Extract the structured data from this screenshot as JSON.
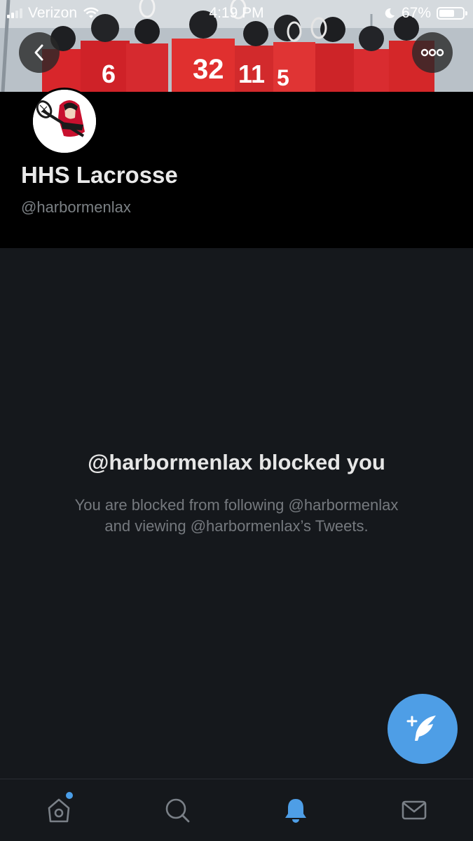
{
  "status_bar": {
    "carrier": "Verizon",
    "time": "4:19 PM",
    "battery": "67%",
    "battery_level": 0.67,
    "signal_bars": 2
  },
  "banner": {
    "jersey_numbers": [
      "32",
      "6",
      "11",
      "5"
    ]
  },
  "profile": {
    "name": "HHS Lacrosse",
    "handle": "@harbormenlax"
  },
  "blocked": {
    "title": "@harbormenlax blocked you",
    "description_line1": "You are blocked from following @harbormenlax",
    "description_line2": "and viewing @harbormenlax’s Tweets."
  },
  "tabbar": {
    "items": [
      {
        "icon": "home-icon",
        "active": false,
        "has_dot": true
      },
      {
        "icon": "search-icon",
        "active": false
      },
      {
        "icon": "bell-icon",
        "active": true
      },
      {
        "icon": "mail-icon",
        "active": false
      }
    ]
  },
  "colors": {
    "accent": "#4e9ee6",
    "background": "#15181c",
    "header": "#000000",
    "secondary_text": "#75797e"
  }
}
